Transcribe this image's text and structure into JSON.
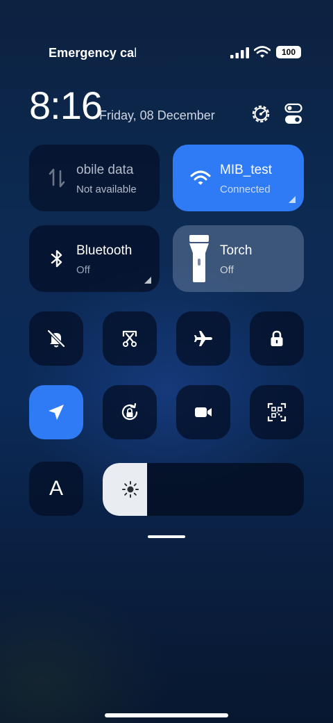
{
  "status_bar": {
    "carrier_text": "Emergency cal",
    "battery": "100"
  },
  "header": {
    "time": "8:16",
    "date": "Friday, 08 December"
  },
  "tiles": {
    "mobile_data": {
      "title": "obile data",
      "status": "Not available"
    },
    "wifi": {
      "title": "MIB_test",
      "status": "Connected"
    },
    "bluetooth": {
      "title": "Bluetooth",
      "status": "Off"
    },
    "torch": {
      "title": "Torch",
      "status": "Off"
    }
  },
  "quick_toggles": {
    "font_label": "A"
  },
  "brightness": {
    "level_percent": 22
  },
  "icons": {
    "row1": [
      "bell-off-icon",
      "screen-cast-icon",
      "airplane-icon",
      "lock-icon"
    ],
    "row2": [
      "location-icon",
      "rotation-lock-icon",
      "video-camera-icon",
      "qr-scan-icon"
    ]
  },
  "colors": {
    "accent": "#2f7bf5",
    "tile_dark": "#041028",
    "background": "#0c2a52"
  }
}
